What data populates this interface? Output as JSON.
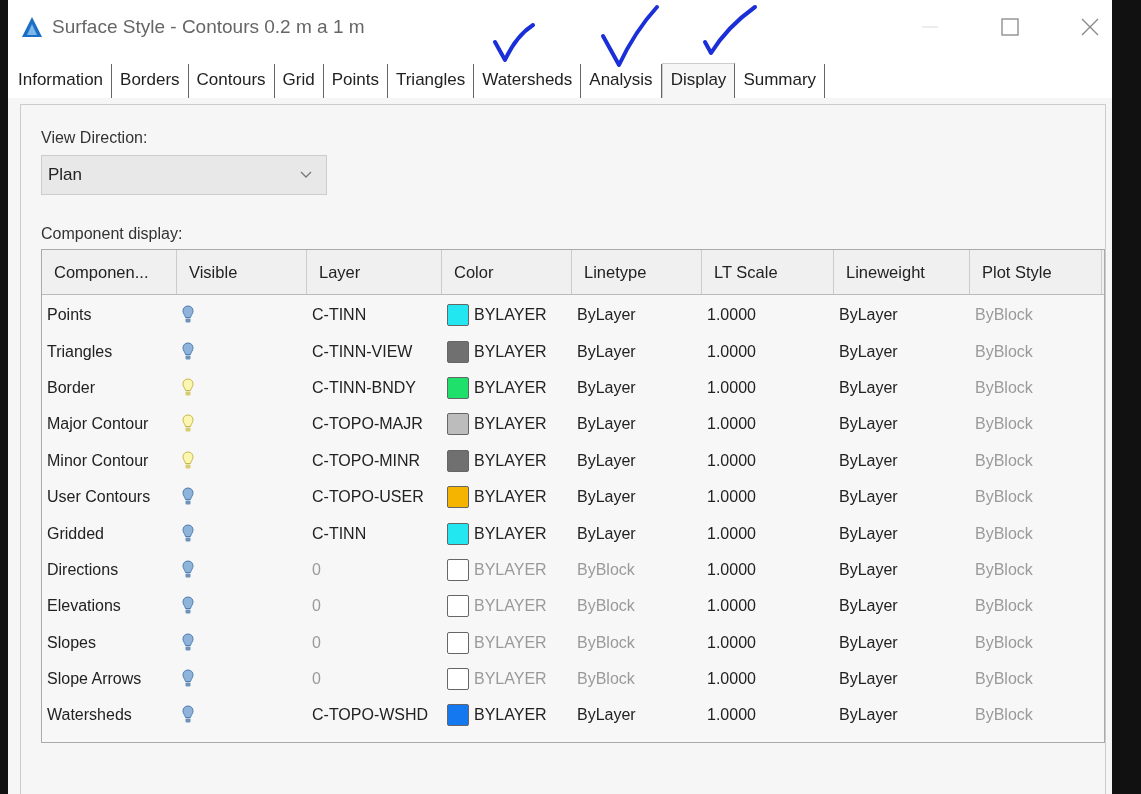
{
  "window": {
    "title": "Surface Style - Contours 0.2 m a 1 m"
  },
  "tabs": [
    {
      "label": "Information",
      "selected": false
    },
    {
      "label": "Borders",
      "selected": false
    },
    {
      "label": "Contours",
      "selected": false
    },
    {
      "label": "Grid",
      "selected": false
    },
    {
      "label": "Points",
      "selected": false
    },
    {
      "label": "Triangles",
      "selected": false
    },
    {
      "label": "Watersheds",
      "selected": false
    },
    {
      "label": "Analysis",
      "selected": false
    },
    {
      "label": "Display",
      "selected": true
    },
    {
      "label": "Summary",
      "selected": false
    }
  ],
  "view_direction": {
    "label": "View Direction:",
    "value": "Plan"
  },
  "component_display": {
    "label": "Component display:",
    "columns": [
      "Componen...",
      "Visible",
      "Layer",
      "Color",
      "Linetype",
      "LT Scale",
      "Lineweight",
      "Plot Style"
    ],
    "rows": [
      {
        "component": "Points",
        "visible": false,
        "layer": "C-TINN",
        "color": "#22e6f0",
        "color_label": "BYLAYER",
        "linetype": "ByLayer",
        "lt_scale": "1.0000",
        "lineweight": "ByLayer",
        "plot_style": "ByBlock",
        "dimmed": false
      },
      {
        "component": "Triangles",
        "visible": false,
        "layer": "C-TINN-VIEW",
        "color": "#707070",
        "color_label": "BYLAYER",
        "linetype": "ByLayer",
        "lt_scale": "1.0000",
        "lineweight": "ByLayer",
        "plot_style": "ByBlock",
        "dimmed": false
      },
      {
        "component": "Border",
        "visible": true,
        "layer": "C-TINN-BNDY",
        "color": "#1ee06a",
        "color_label": "BYLAYER",
        "linetype": "ByLayer",
        "lt_scale": "1.0000",
        "lineweight": "ByLayer",
        "plot_style": "ByBlock",
        "dimmed": false
      },
      {
        "component": "Major Contour",
        "visible": true,
        "layer": "C-TOPO-MAJR",
        "color": "#bcbcbc",
        "color_label": "BYLAYER",
        "linetype": "ByLayer",
        "lt_scale": "1.0000",
        "lineweight": "ByLayer",
        "plot_style": "ByBlock",
        "dimmed": false
      },
      {
        "component": "Minor Contour",
        "visible": true,
        "layer": "C-TOPO-MINR",
        "color": "#707070",
        "color_label": "BYLAYER",
        "linetype": "ByLayer",
        "lt_scale": "1.0000",
        "lineweight": "ByLayer",
        "plot_style": "ByBlock",
        "dimmed": false
      },
      {
        "component": "User Contours",
        "visible": false,
        "layer": "C-TOPO-USER",
        "color": "#f5b400",
        "color_label": "BYLAYER",
        "linetype": "ByLayer",
        "lt_scale": "1.0000",
        "lineweight": "ByLayer",
        "plot_style": "ByBlock",
        "dimmed": false
      },
      {
        "component": "Gridded",
        "visible": false,
        "layer": "C-TINN",
        "color": "#22e6f0",
        "color_label": "BYLAYER",
        "linetype": "ByLayer",
        "lt_scale": "1.0000",
        "lineweight": "ByLayer",
        "plot_style": "ByBlock",
        "dimmed": false
      },
      {
        "component": "Directions",
        "visible": false,
        "layer": "0",
        "color": "#ffffff",
        "color_label": "BYLAYER",
        "linetype": "ByBlock",
        "lt_scale": "1.0000",
        "lineweight": "ByLayer",
        "plot_style": "ByBlock",
        "dimmed": true
      },
      {
        "component": "Elevations",
        "visible": false,
        "layer": "0",
        "color": "#ffffff",
        "color_label": "BYLAYER",
        "linetype": "ByBlock",
        "lt_scale": "1.0000",
        "lineweight": "ByLayer",
        "plot_style": "ByBlock",
        "dimmed": true
      },
      {
        "component": "Slopes",
        "visible": false,
        "layer": "0",
        "color": "#ffffff",
        "color_label": "BYLAYER",
        "linetype": "ByBlock",
        "lt_scale": "1.0000",
        "lineweight": "ByLayer",
        "plot_style": "ByBlock",
        "dimmed": true
      },
      {
        "component": "Slope Arrows",
        "visible": false,
        "layer": "0",
        "color": "#ffffff",
        "color_label": "BYLAYER",
        "linetype": "ByBlock",
        "lt_scale": "1.0000",
        "lineweight": "ByLayer",
        "plot_style": "ByBlock",
        "dimmed": true
      },
      {
        "component": "Watersheds",
        "visible": false,
        "layer": "C-TOPO-WSHD",
        "color": "#1478f0",
        "color_label": "BYLAYER",
        "linetype": "ByLayer",
        "lt_scale": "1.0000",
        "lineweight": "ByLayer",
        "plot_style": "ByBlock",
        "dimmed": false
      }
    ]
  }
}
